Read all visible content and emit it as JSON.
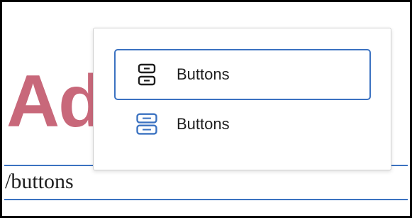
{
  "background": {
    "heading_text": "Ad",
    "input_text": "/buttons"
  },
  "menu": {
    "options": [
      {
        "label": "Buttons",
        "icon": "buttons-block-icon",
        "selected": true
      },
      {
        "label": "Buttons",
        "icon": "buttons-block-icon",
        "selected": false
      }
    ]
  },
  "colors": {
    "accent": "#3b72c1",
    "heading": "#c8687a",
    "text": "#1e1e1e"
  }
}
